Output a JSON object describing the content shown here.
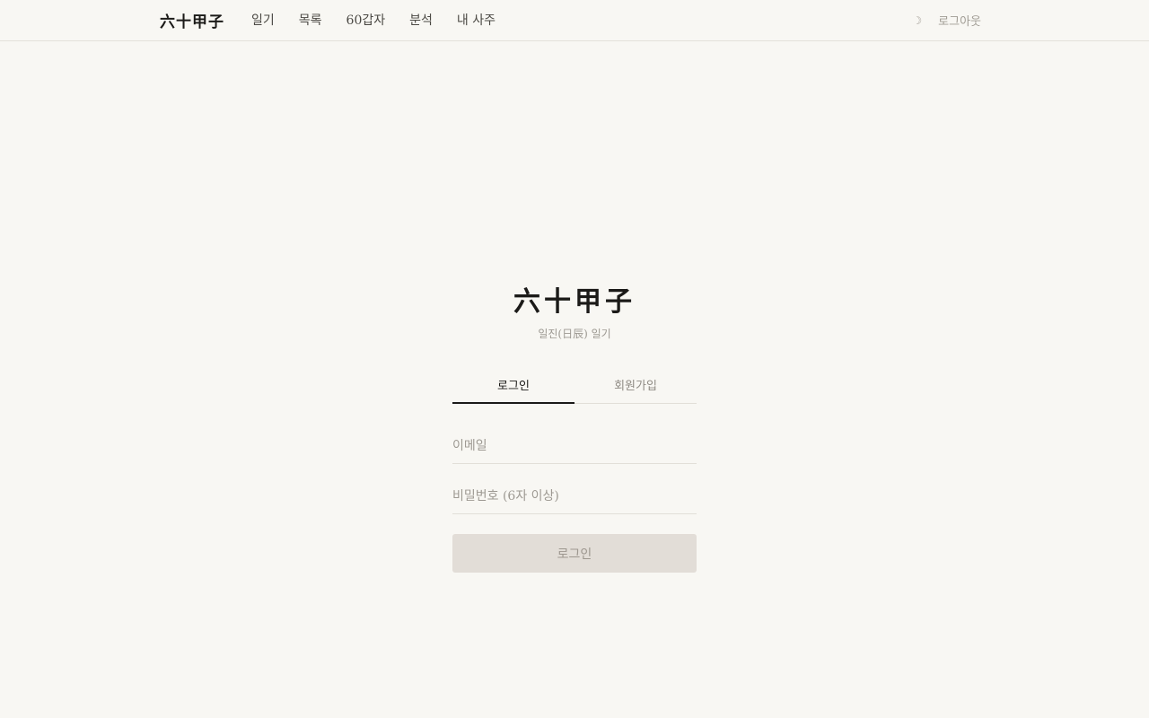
{
  "header": {
    "brand": "六十甲子",
    "nav": [
      "일기",
      "목록",
      "60갑자",
      "분석",
      "내 사주"
    ],
    "theme_icon": "moon-icon",
    "logout_label": "로그아웃"
  },
  "auth": {
    "logo": "六十甲子",
    "subtitle": "일진(日辰) 일기",
    "tabs": [
      "로그인",
      "회원가입"
    ],
    "active_tab": "로그인",
    "email_placeholder": "이메일",
    "password_placeholder": "비밀번호 (6자 이상)",
    "submit_label": "로그인"
  },
  "colors": {
    "background": "#f8f7f3",
    "text": "#1b1a18",
    "muted": "#9d9992",
    "button": "#e2ddd7"
  }
}
